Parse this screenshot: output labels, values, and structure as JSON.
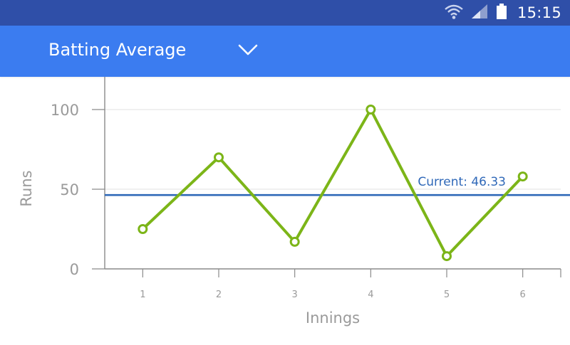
{
  "status_bar": {
    "time": "15:15",
    "icons": [
      "wifi-icon",
      "cell-signal-icon",
      "battery-icon"
    ],
    "background_color": "#2f4fa8"
  },
  "app_bar": {
    "title": "Batting Average",
    "dropdown_icon": "chevron-down-icon",
    "background_color": "#3b7cf0"
  },
  "chart_data": {
    "type": "line",
    "title": "",
    "xlabel": "Innings",
    "ylabel": "Runs",
    "x": [
      1,
      2,
      3,
      4,
      5,
      6
    ],
    "x_tick_labels": [
      "1",
      "2",
      "3",
      "4",
      "5",
      "6"
    ],
    "y_tick_labels": [
      "0",
      "50",
      "100"
    ],
    "y_ticks": [
      0,
      50,
      100
    ],
    "ylim": [
      0,
      100
    ],
    "xlim": [
      0.5,
      6.5
    ],
    "grid": true,
    "series": [
      {
        "values": [
          25,
          70,
          17,
          100,
          8,
          58
        ],
        "color": "#7cb518",
        "marker": "hollow-circle"
      }
    ],
    "reference_line": {
      "value": 46.33,
      "label": "Current: 46.33",
      "color": "#2f68b8"
    }
  }
}
